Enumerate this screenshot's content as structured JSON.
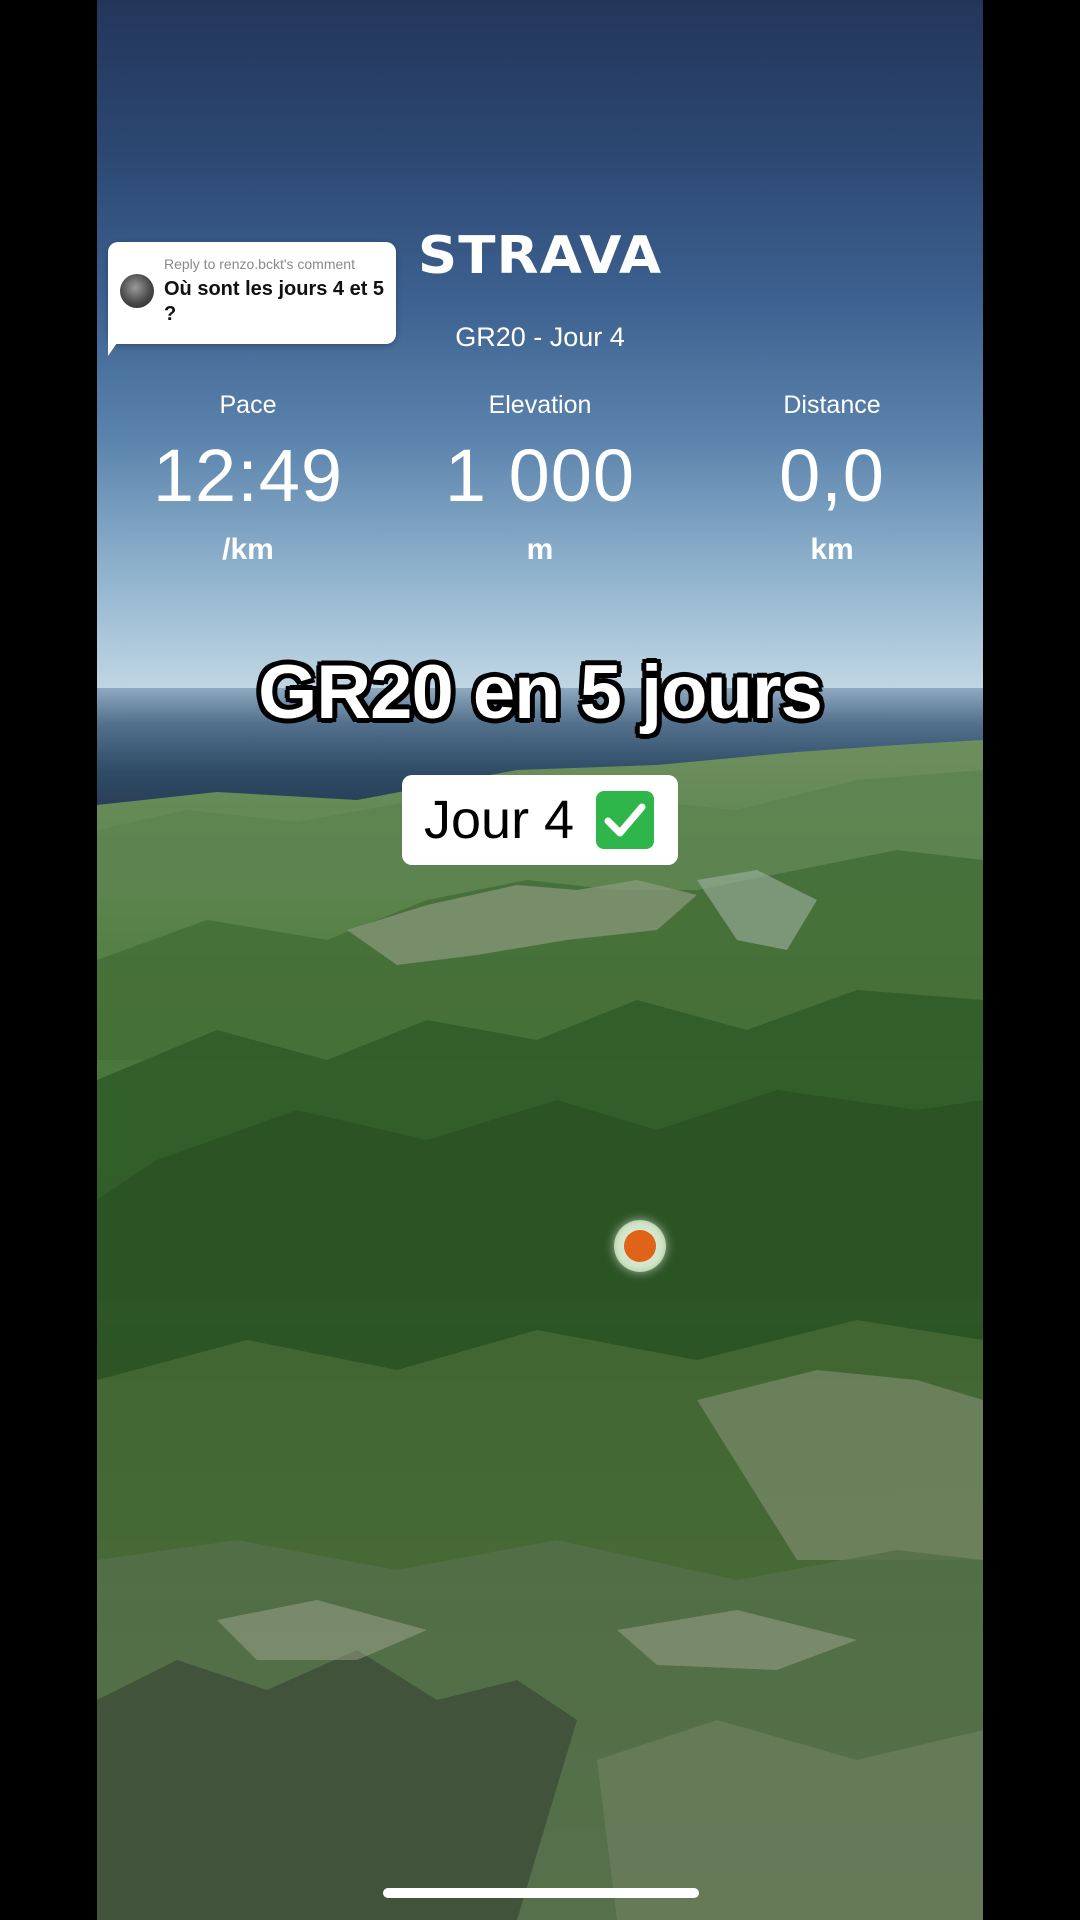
{
  "comment": {
    "reply_to": "Reply to renzo.bckt's comment",
    "text": "Où sont les jours 4 et 5 ?"
  },
  "strava": {
    "logo": "STRAVA",
    "activity_title": "GR20 - Jour 4"
  },
  "stats": {
    "pace": {
      "label": "Pace",
      "value": "12:49",
      "unit": "/km"
    },
    "elevation": {
      "label": "Elevation",
      "value": "1 000",
      "unit": "m"
    },
    "distance": {
      "label": "Distance",
      "value": "0,0",
      "unit": "km"
    }
  },
  "caption": "GR20 en 5 jours",
  "day_badge": {
    "label": "Jour 4",
    "icon": "check-mark-button-icon",
    "icon_color": "#2eb64a"
  },
  "marker": {
    "icon": "current-position-marker-icon",
    "color": "#e0631a"
  },
  "colors": {
    "sky_top": "#23365a",
    "terrain_green": "#3f6f35",
    "marker_orange": "#e0631a"
  }
}
